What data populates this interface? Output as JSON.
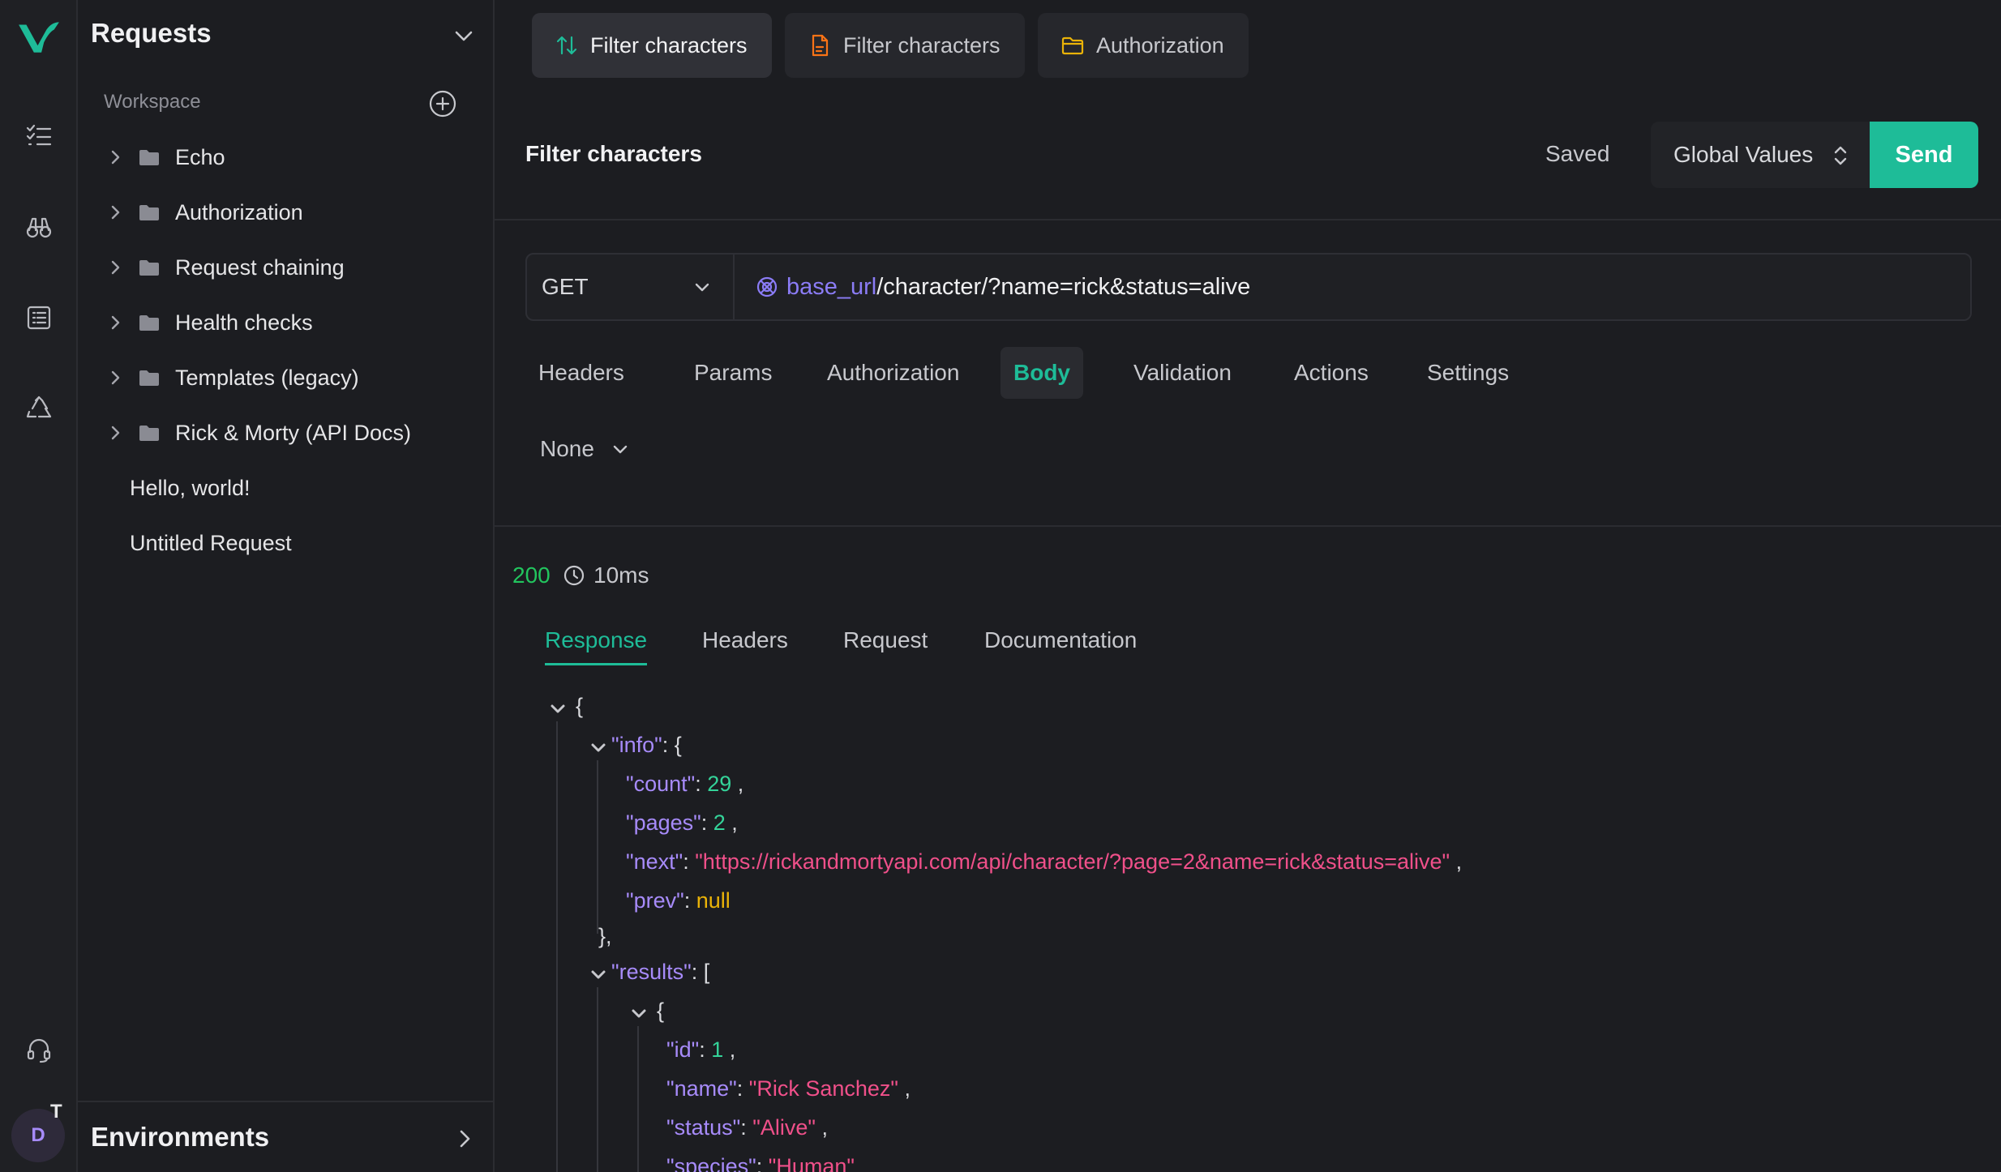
{
  "colors": {
    "accent": "#1ebc98",
    "status_ok": "#22c55e",
    "var": "#8b7cf6",
    "key": "#a78bfa",
    "string": "#f0508a",
    "number": "#34d399",
    "null": "#eab308"
  },
  "rail": {
    "icons": [
      "logo-icon",
      "checklist-icon",
      "binoculars-icon",
      "list-icon",
      "recycle-icon",
      "headset-icon"
    ],
    "avatar_initial": "D",
    "avatar_badge": "T"
  },
  "sidebar": {
    "title": "Requests",
    "workspace_label": "Workspace",
    "folders": [
      {
        "label": "Echo"
      },
      {
        "label": "Authorization"
      },
      {
        "label": "Request chaining"
      },
      {
        "label": "Health checks"
      },
      {
        "label": "Templates (legacy)"
      },
      {
        "label": "Rick & Morty (API Docs)"
      }
    ],
    "requests": [
      {
        "label": "Hello, world!"
      },
      {
        "label": "Untitled Request"
      }
    ],
    "environments_label": "Environments"
  },
  "tabs": [
    {
      "label": "Filter characters",
      "icon": "arrows-up-down-icon",
      "active": true
    },
    {
      "label": "Filter characters",
      "icon": "document-icon",
      "active": false
    },
    {
      "label": "Authorization",
      "icon": "folder-icon",
      "active": false
    }
  ],
  "request": {
    "title": "Filter characters",
    "saved_label": "Saved",
    "environment": "Global Values",
    "send_label": "Send",
    "method": "GET",
    "url_variable": "base_url",
    "url_path": "/character/?name=rick&status=alive",
    "tabs": [
      "Headers",
      "Params",
      "Authorization",
      "Body",
      "Validation",
      "Actions",
      "Settings"
    ],
    "active_tab": "Body",
    "body_type": "None"
  },
  "response": {
    "status": "200",
    "elapsed": "10ms",
    "tabs": [
      "Response",
      "Headers",
      "Request",
      "Documentation"
    ],
    "active_tab": "Response",
    "json": {
      "open_brace": "{",
      "info_key": "\"info\"",
      "info_open": ": {",
      "count_key": "\"count\"",
      "count_val": "29",
      "pages_key": "\"pages\"",
      "pages_val": "2",
      "next_key": "\"next\"",
      "next_val": "\"https://rickandmortyapi.com/api/character/?page=2&name=rick&status=alive\"",
      "prev_key": "\"prev\"",
      "prev_val": "null",
      "info_close": "},",
      "results_key": "\"results\"",
      "results_open": ": [",
      "item_open": "{",
      "id_key": "\"id\"",
      "id_val": "1",
      "name_key": "\"name\"",
      "name_val": "\"Rick Sanchez\"",
      "status_key": "\"status\"",
      "status_val": "\"Alive\"",
      "species_key": "\"species\"",
      "species_val": "\"Human\"",
      "colon": ": ",
      "comma": " ,"
    }
  }
}
